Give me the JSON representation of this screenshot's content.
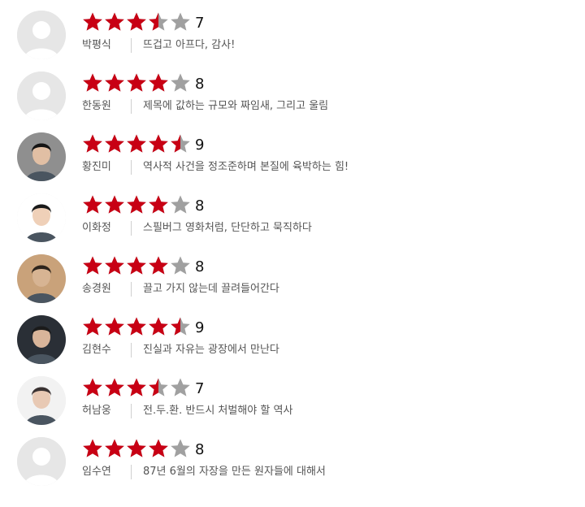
{
  "colors": {
    "star_filled": "#c80014",
    "star_empty": "#a0a0a0",
    "text": "#555555",
    "score": "#111111",
    "divider": "#cfcfcf"
  },
  "reviews": [
    {
      "name": "박평식",
      "score": "7",
      "stars": 3.5,
      "comment": "뜨겁고 아프다, 감사!",
      "avatar": "default-avatar"
    },
    {
      "name": "한동원",
      "score": "8",
      "stars": 4,
      "comment": "제목에 값하는 규모와 짜임새, 그리고 울림",
      "avatar": "default-avatar"
    },
    {
      "name": "황진미",
      "score": "9",
      "stars": 4.5,
      "comment": "역사적 사건을 정조준하며 본질에 육박하는 힘!",
      "avatar": "photo-avatar"
    },
    {
      "name": "이화정",
      "score": "8",
      "stars": 4,
      "comment": "스필버그 영화처럼, 단단하고 묵직하다",
      "avatar": "photo-avatar"
    },
    {
      "name": "송경원",
      "score": "8",
      "stars": 4,
      "comment": "끌고 가지 않는데 끌려들어간다",
      "avatar": "photo-avatar"
    },
    {
      "name": "김현수",
      "score": "9",
      "stars": 4.5,
      "comment": "진실과 자유는 광장에서 만난다",
      "avatar": "photo-avatar"
    },
    {
      "name": "허남웅",
      "score": "7",
      "stars": 3.5,
      "comment": "전.두.환. 반드시 처벌해야 할 역사",
      "avatar": "photo-avatar"
    },
    {
      "name": "임수연",
      "score": "8",
      "stars": 4,
      "comment": "87년 6월의 자장을 만든 원자들에 대해서",
      "avatar": "default-avatar"
    }
  ]
}
